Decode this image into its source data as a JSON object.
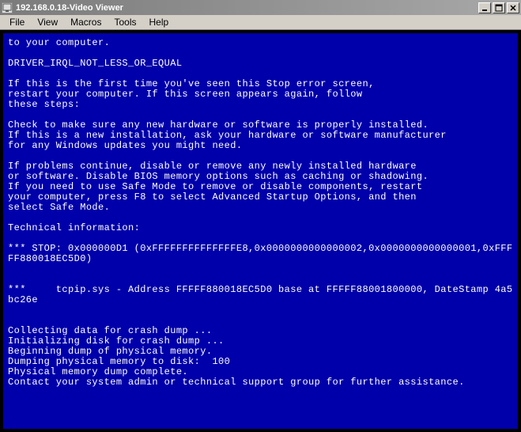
{
  "window": {
    "title": "192.168.0.18-Video Viewer"
  },
  "menubar": {
    "file": "File",
    "view": "View",
    "macros": "Macros",
    "tools": "Tools",
    "help": "Help"
  },
  "bsod": {
    "line1": "to your computer.",
    "blank1": "",
    "error_code": "DRIVER_IRQL_NOT_LESS_OR_EQUAL",
    "blank2": "",
    "first_time1": "If this is the first time you've seen this Stop error screen,",
    "first_time2": "restart your computer. If this screen appears again, follow",
    "first_time3": "these steps:",
    "blank3": "",
    "check1": "Check to make sure any new hardware or software is properly installed.",
    "check2": "If this is a new installation, ask your hardware or software manufacturer",
    "check3": "for any Windows updates you might need.",
    "blank4": "",
    "problems1": "If problems continue, disable or remove any newly installed hardware",
    "problems2": "or software. Disable BIOS memory options such as caching or shadowing.",
    "problems3": "If you need to use Safe Mode to remove or disable components, restart",
    "problems4": "your computer, press F8 to select Advanced Startup Options, and then",
    "problems5": "select Safe Mode.",
    "blank5": "",
    "tech_info": "Technical information:",
    "blank6": "",
    "stop_line": "*** STOP: 0x000000D1 (0xFFFFFFFFFFFFFFE8,0x0000000000000002,0x0000000000000001,0xFFFFF880018EC5D0)",
    "blank7": "",
    "blank8": "",
    "driver_line": "***     tcpip.sys - Address FFFFF880018EC5D0 base at FFFFF88001800000, DateStamp 4a5bc26e",
    "blank9": "",
    "blank10": "",
    "collect1": "Collecting data for crash dump ...",
    "collect2": "Initializing disk for crash dump ...",
    "collect3": "Beginning dump of physical memory.",
    "collect4": "Dumping physical memory to disk:  100",
    "collect5": "Physical memory dump complete.",
    "collect6": "Contact your system admin or technical support group for further assistance."
  }
}
